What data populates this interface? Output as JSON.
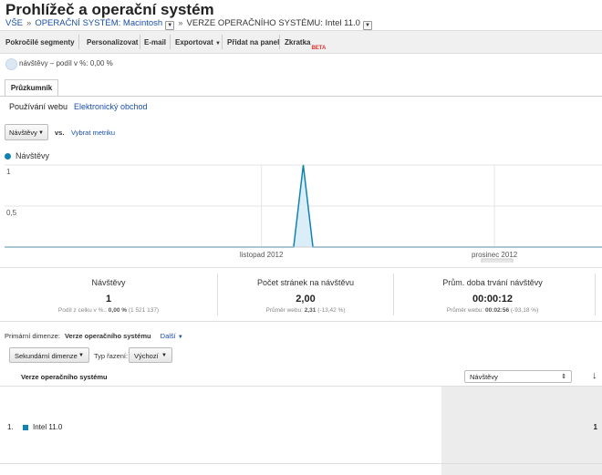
{
  "page": {
    "title": "Prohlížeč a operační systém",
    "breadcrumb": [
      {
        "label": "VŠE",
        "link": true
      },
      {
        "label": "OPERAČNÍ SYSTÉM: Macintosh",
        "link": true
      },
      {
        "label": "VERZE OPERAČNÍHO SYSTÉMU: Intel 11.0",
        "link": false
      }
    ]
  },
  "toolbar": {
    "advanced_segments": "Pokročilé segmenty",
    "customize": "Personalizovat",
    "email": "E-mail",
    "export": "Exportovat",
    "add_to_dashboard": "Přidat na panel",
    "shortcut": "Zkratka",
    "beta": "BETA"
  },
  "segment": {
    "label": "návštěvy – podíl v %: 0,00 %"
  },
  "tabs": {
    "explorer": "Průzkumník"
  },
  "subtabs": {
    "site_usage": "Používání webu",
    "ecommerce": "Elektronický obchod"
  },
  "metric_picker": {
    "selected": "Návštěvy",
    "vs": "vs.",
    "select_metric": "Vybrat metriku"
  },
  "chart_data": {
    "type": "line",
    "series": [
      {
        "name": "Návštěvy",
        "color": "#0f83b3",
        "values": [
          0,
          0,
          0,
          0,
          0,
          0,
          0,
          0,
          0,
          0,
          0,
          0,
          0,
          0,
          0,
          0,
          0,
          0,
          0,
          0,
          0,
          0,
          0,
          0,
          0,
          0,
          0,
          0,
          0,
          0,
          0,
          1,
          0,
          0,
          0,
          0,
          0,
          0,
          0,
          0,
          0,
          0,
          0,
          0,
          0,
          0,
          0,
          0,
          0,
          0,
          0,
          0,
          0,
          0,
          0,
          0,
          0,
          0,
          0,
          0,
          0,
          0,
          0
        ]
      }
    ],
    "y_ticks": [
      "1",
      "0,5"
    ],
    "ylim": [
      0,
      1
    ],
    "x_labels": [
      "listopad 2012",
      "prosinec 2012"
    ],
    "grid": true
  },
  "stats": [
    {
      "label": "Návštěvy",
      "value": "1",
      "sub_prefix": "Podíl z celku v %.: ",
      "sub_bold": "0,00 %",
      "sub_suffix": " (1 521 137)"
    },
    {
      "label": "Počet stránek na návštěvu",
      "value": "2,00",
      "sub_prefix": "Průměr webu: ",
      "sub_bold": "2,31",
      "sub_suffix": " (-13,42 %)"
    },
    {
      "label": "Prům. doba trvání návštěvy",
      "value": "00:00:12",
      "sub_prefix": "Průměr webu: ",
      "sub_bold": "00:02:56",
      "sub_suffix": " (-93,18 %)"
    }
  ],
  "dimension": {
    "primary_label": "Primární dimenze:",
    "primary_value": "Verze operačního systému",
    "more": "Další"
  },
  "controls": {
    "secondary": "Sekundární dimenze",
    "sort_label": "Typ řazení:",
    "sort_value": "Výchozí"
  },
  "table": {
    "col_dimension": "Verze operačního systému",
    "col_metric": "Návštěvy",
    "rows": [
      {
        "index": "1.",
        "name": "Intel 11.0",
        "value": "1"
      }
    ]
  },
  "colors": {
    "accent": "#0f83b3",
    "link": "#1a4fa8"
  }
}
